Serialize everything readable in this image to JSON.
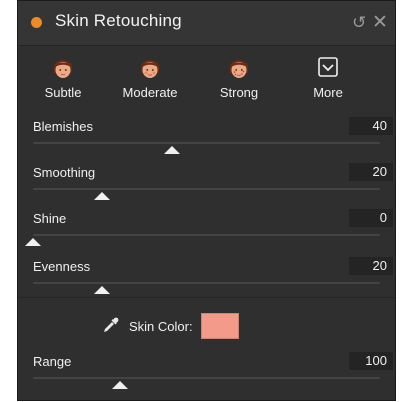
{
  "panel": {
    "title": "Skin Retouching",
    "accent_color": "#f08a24",
    "undo_icon": "undo-icon",
    "close_icon": "close-icon"
  },
  "presets": [
    {
      "label": "Subtle",
      "icon": "face-subtle-icon"
    },
    {
      "label": "Moderate",
      "icon": "face-moderate-icon"
    },
    {
      "label": "Strong",
      "icon": "face-strong-icon"
    },
    {
      "label": "More",
      "icon": "chevron-down-box-icon"
    }
  ],
  "sliders": [
    {
      "label": "Blemishes",
      "value": "40",
      "level": 0.4
    },
    {
      "label": "Smoothing",
      "value": "20",
      "level": 0.2
    },
    {
      "label": "Shine",
      "value": "0",
      "level": 0.0
    },
    {
      "label": "Evenness",
      "value": "20",
      "level": 0.2
    }
  ],
  "skin_color": {
    "label": "Skin Color:",
    "swatch_color": "#f49a8a",
    "icon": "eyedropper-icon"
  },
  "range": {
    "label": "Range",
    "value": "100",
    "level": 0.25
  }
}
